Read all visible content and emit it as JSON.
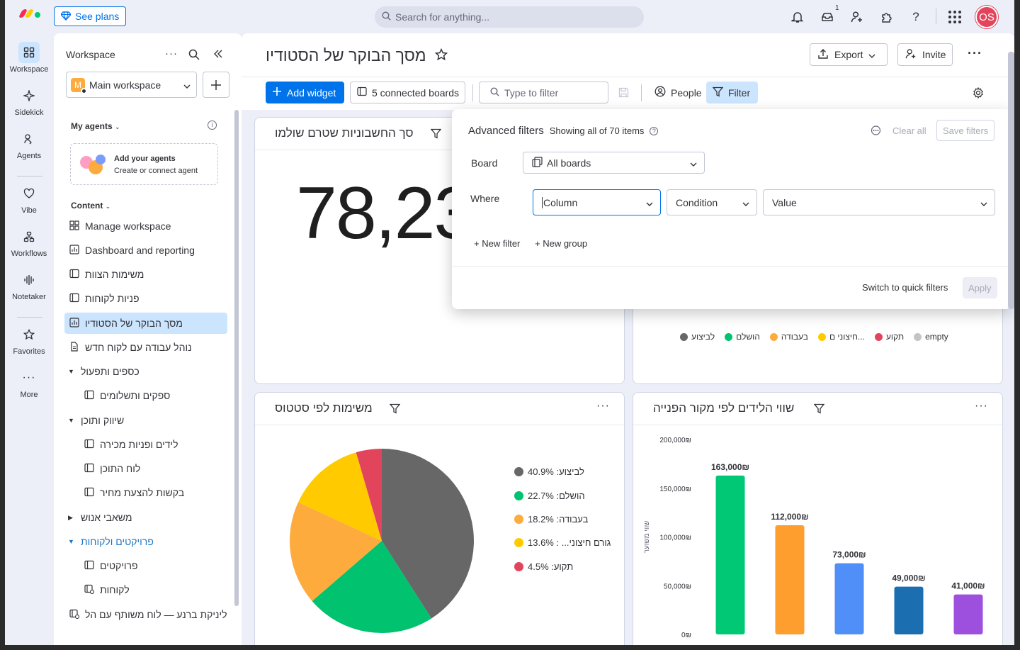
{
  "topbar": {
    "see_plans": "See plans",
    "search_placeholder": "Search for anything...",
    "inbox_count": "1",
    "avatar_initials": "OS"
  },
  "rail": [
    {
      "label": "Workspace",
      "icon": "grid-icon"
    },
    {
      "label": "Sidekick",
      "icon": "sparkle-icon"
    },
    {
      "label": "Agents",
      "icon": "agent-icon"
    },
    {
      "label": "Vibe",
      "icon": "heart-icon"
    },
    {
      "label": "Workflows",
      "icon": "workflow-icon"
    },
    {
      "label": "Notetaker",
      "icon": "waveform-icon"
    },
    {
      "label": "Favorites",
      "icon": "star-icon"
    },
    {
      "label": "More",
      "icon": "more-icon"
    }
  ],
  "sidebar": {
    "title": "Workspace",
    "workspace_name": "Main workspace",
    "workspace_initial": "M",
    "my_agents": "My agents",
    "agent_card_title": "Add your agents",
    "agent_card_sub": "Create or connect agent",
    "content": "Content",
    "items": [
      "Manage workspace",
      "Dashboard and reporting",
      "משימות הצוות",
      "פניות לקוחות",
      "מסך הבוקר של הסטודיו",
      "נוהל עבודה עם לקוח חדש",
      "כספים ותפעול",
      "ספקים ותשלומים",
      "שיווק ותוכן",
      "לידים ופניות מכירה",
      "לוח התוכן",
      "בקשות להצעת מחיר",
      "משאבי אנוש",
      "פרויקטים ולקוחות",
      "פרויקטים",
      "לקוחות",
      "ליניקת ברנע — לוח משותף עם הל..."
    ]
  },
  "main": {
    "title": "מסך הבוקר של הסטודיו",
    "export": "Export",
    "invite": "Invite",
    "add_widget": "Add widget",
    "connected_boards": "5 connected boards",
    "filter_placeholder": "Type to filter",
    "people": "People",
    "filter": "Filter"
  },
  "widgets": {
    "number_title": "סך החשבוניות שטרם שולמו",
    "number_value": "78,23",
    "status_legend": [
      "לביצוע",
      "הושלם",
      "בעבודה",
      "חיצוני ם...",
      "תקוע",
      "empty"
    ],
    "pie_title": "משימות לפי סטטוס",
    "bar_title": "שווי הלידים לפי מקור הפנייה",
    "bar_ylabel": "שווי משוער"
  },
  "colors": {
    "grey": "#676767",
    "green": "#00c26f",
    "orange": "#fdab3d",
    "yellow": "#ffcb00",
    "red": "#e2445c",
    "light": "#c4c4c4",
    "green_bar": "#00c875",
    "orange_bar": "#fe9e2e",
    "blue_bar": "#4f8ff7",
    "darkblue_bar": "#1b6fb0",
    "purple_bar": "#9d50dd"
  },
  "chart_data": [
    {
      "type": "pie",
      "title": "משימות לפי סטטוס",
      "categories": [
        "לביצוע",
        "הושלם",
        "בעבודה",
        "גורם חיצוני...",
        "תקוע"
      ],
      "values": [
        40.9,
        22.7,
        18.2,
        13.6,
        4.5
      ],
      "labels": [
        "לביצוע: 40.9%",
        "הושלם: 22.7%",
        "בעבודה: 18.2%",
        "גורם חיצוני... : 13.6%",
        "תקוע: 4.5%"
      ],
      "colors": [
        "#676767",
        "#00c26f",
        "#fdab3d",
        "#ffcb00",
        "#e2445c"
      ],
      "legend": "right"
    },
    {
      "type": "bar",
      "title": "שווי הלידים לפי מקור הפנייה",
      "ylabel": "שווי משוער",
      "values": [
        163000,
        112000,
        73000,
        49000,
        41000
      ],
      "data_labels": [
        "163,000₪",
        "112,000₪",
        "73,000₪",
        "49,000₪",
        "41,000₪"
      ],
      "colors": [
        "#00c875",
        "#fe9e2e",
        "#4f8ff7",
        "#1b6fb0",
        "#9d50dd"
      ],
      "ylim": [
        0,
        200000
      ],
      "yticks": [
        "0₪",
        "50,000₪",
        "100,000₪",
        "150,000₪",
        "200,000₪"
      ],
      "grid": false
    }
  ],
  "advanced_filters": {
    "title": "Advanced filters",
    "showing": "Showing all of 70 items",
    "clear_all": "Clear all",
    "save_filters": "Save filters",
    "board_label": "Board",
    "board_value": "All boards",
    "where_label": "Where",
    "column": "Column",
    "condition": "Condition",
    "value": "Value",
    "new_filter": "+ New filter",
    "new_group": "+ New group",
    "switch_quick": "Switch to quick filters",
    "apply": "Apply"
  }
}
